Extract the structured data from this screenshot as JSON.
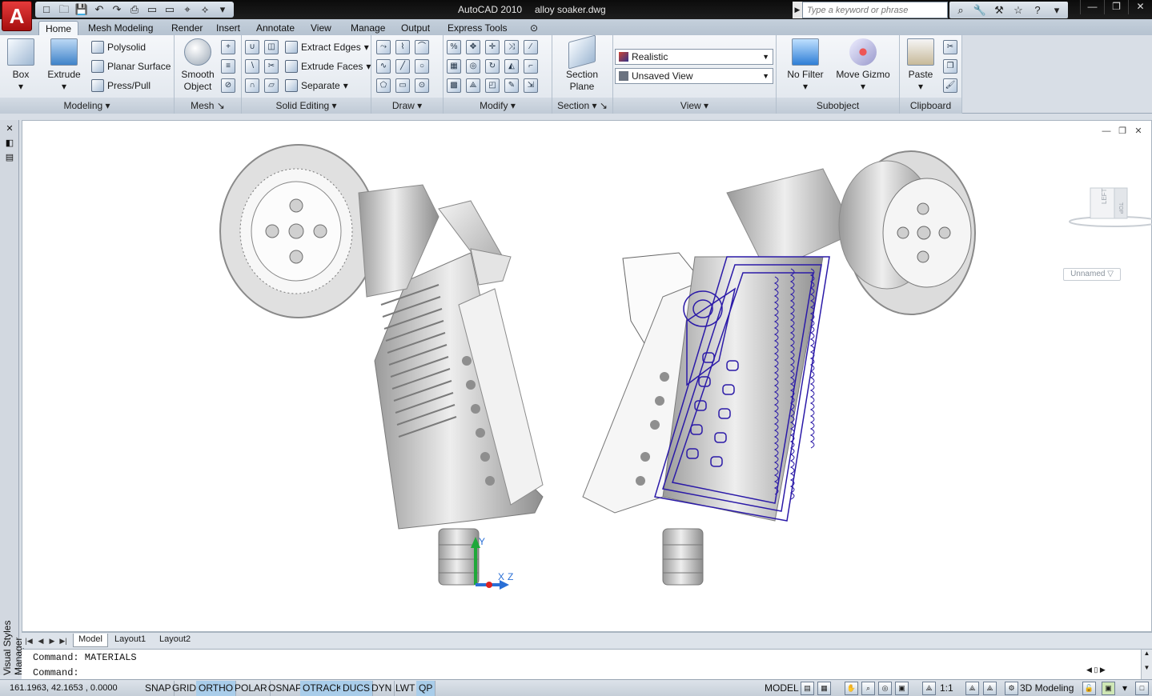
{
  "window": {
    "app_title": "AutoCAD 2010",
    "file_name": "alloy soaker.dwg",
    "app_logo": "A",
    "search_placeholder": "Type a keyword or phrase",
    "controls": [
      "—",
      "❐",
      "✕"
    ]
  },
  "qat": [
    "□",
    "🗀",
    "💾",
    "↶",
    "↷",
    "⎙",
    "▭",
    "▭",
    "⌖",
    "⟡",
    "▾"
  ],
  "help_tools": [
    "⌕",
    "🔧",
    "⚒",
    "☆",
    "?",
    "▾"
  ],
  "tabs": [
    {
      "label": "Home",
      "active": true
    },
    {
      "label": "Mesh Modeling"
    },
    {
      "label": "Render"
    },
    {
      "label": "Insert"
    },
    {
      "label": "Annotate"
    },
    {
      "label": "View"
    },
    {
      "label": "Manage"
    },
    {
      "label": "Output"
    },
    {
      "label": "Express Tools"
    },
    {
      "label": "⊙"
    }
  ],
  "panels": {
    "modeling": {
      "title": "Modeling",
      "box_label": "Box",
      "extrude_label": "Extrude",
      "polysolid_label": "Polysolid",
      "planar_surface_label": "Planar Surface",
      "presspull_label": "Press/Pull"
    },
    "mesh": {
      "title": "Mesh",
      "smooth_line1": "Smooth",
      "smooth_line2": "Object"
    },
    "solid_editing": {
      "title": "Solid Editing",
      "extract_edges": "Extract Edges",
      "extrude_faces": "Extrude Faces",
      "separate": "Separate"
    },
    "draw": {
      "title": "Draw"
    },
    "modify": {
      "title": "Modify"
    },
    "section": {
      "title": "Section",
      "plane_line1": "Section",
      "plane_line2": "Plane"
    },
    "view": {
      "title": "View",
      "visual_style": "Realistic",
      "named_view": "Unsaved View"
    },
    "subobject": {
      "title": "Subobject",
      "no_filter": "No Filter",
      "move_gizmo": "Move Gizmo"
    },
    "clipboard": {
      "title": "Clipboard",
      "paste": "Paste"
    }
  },
  "palette": {
    "label": "Visual Styles Manager",
    "buttons": [
      "✕",
      "◧",
      "▤"
    ]
  },
  "viewport": {
    "controls": [
      "—",
      "❐",
      "✕"
    ],
    "viewcube_left": "LEFT",
    "viewcube_top": "TOP",
    "ucs_name": "Unnamed ▽",
    "ucs_x": "X",
    "ucs_y": "Y",
    "ucs_z": "Z",
    "colors": {
      "model_fill": "#c8c8c8",
      "model_edge": "#7c7c7c",
      "selection": "#2b1aa8"
    }
  },
  "layout_tabs": [
    "Model",
    "Layout1",
    "Layout2"
  ],
  "command": {
    "line1": "Command: MATERIALS",
    "line2": "Command:"
  },
  "status": {
    "coords": "161.1963, 42.1653 , 0.0000",
    "toggles": [
      {
        "label": "SNAP",
        "on": false
      },
      {
        "label": "GRID",
        "on": false
      },
      {
        "label": "ORTHO",
        "on": true
      },
      {
        "label": "POLAR",
        "on": false
      },
      {
        "label": "OSNAP",
        "on": false
      },
      {
        "label": "OTRACK",
        "on": true
      },
      {
        "label": "DUCS",
        "on": true
      },
      {
        "label": "DYN",
        "on": false
      },
      {
        "label": "LWT",
        "on": false
      },
      {
        "label": "QP",
        "on": true
      }
    ],
    "model": "MODEL",
    "scale": "1:1",
    "workspace": "3D Modeling"
  }
}
